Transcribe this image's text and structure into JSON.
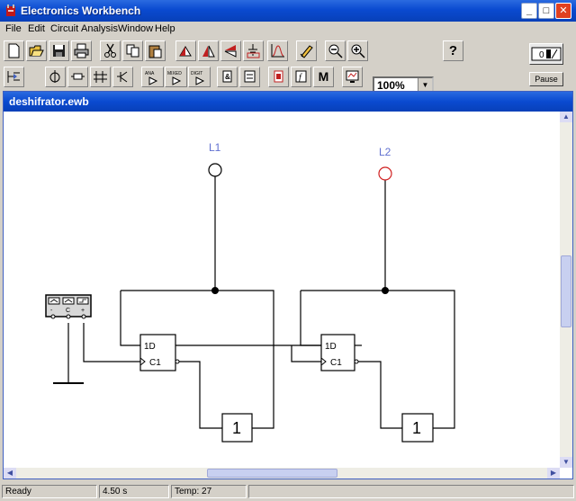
{
  "window": {
    "title": "Electronics Workbench",
    "minimize": "_",
    "maximize": "□",
    "close": "✕"
  },
  "menu": [
    "File",
    "Edit",
    "Circuit",
    "Analysis",
    "Window",
    "Help"
  ],
  "toolbar": {
    "zoom_value": "100%",
    "help_label": "?",
    "pause_label": "Pause",
    "ana_label": "ANA",
    "mixed_label": "MIXED",
    "digit_label": "DIGIT",
    "misc_label": "M"
  },
  "document": {
    "title": "deshifrator.ewb"
  },
  "circuit": {
    "probe1_label": "L1",
    "probe2_label": "L2",
    "ff1_d": "1D",
    "ff1_c": "C1",
    "ff2_d": "1D",
    "ff2_c": "C1",
    "inv1": "1",
    "inv2": "1",
    "gen_minus": "-",
    "gen_com": "C",
    "gen_plus": "+"
  },
  "status": {
    "state": "Ready",
    "time": "4.50 s",
    "temp": "Temp:  27"
  },
  "colors": {
    "titlebar": "#0a4ad0",
    "probe_off": "#000000",
    "probe_on": "#d02020",
    "label": "#6070d0"
  }
}
